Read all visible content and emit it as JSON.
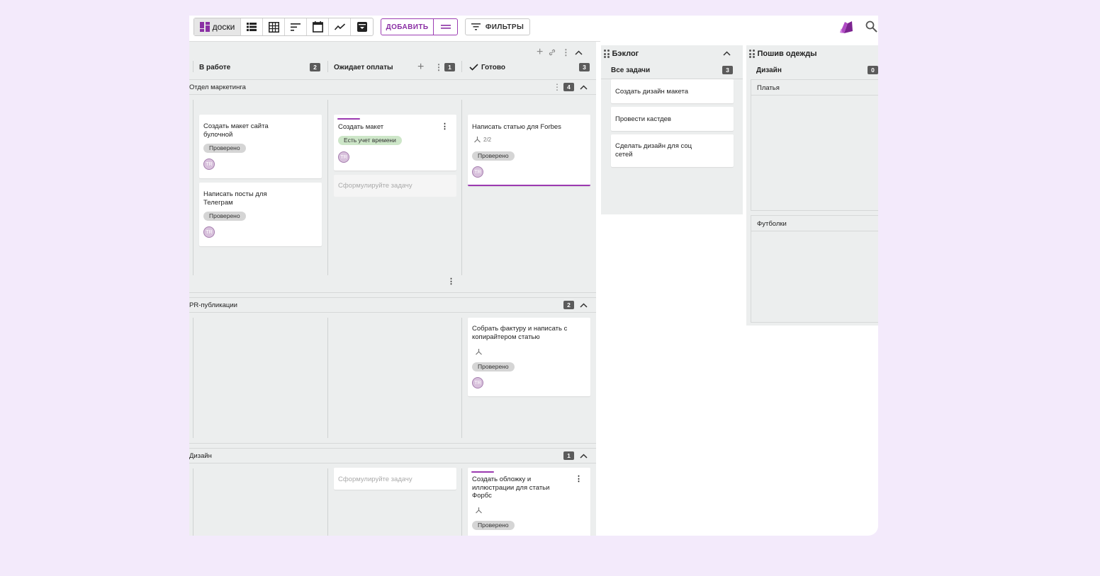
{
  "toolbar": {
    "boards_label": "доски",
    "add_label": "ДОБАВИТЬ",
    "filters_label": "ФИЛЬТРЫ",
    "view_icons": [
      "list-view-icon",
      "table-view-icon",
      "sort-icon",
      "calendar-icon",
      "chart-icon",
      "archive-icon"
    ]
  },
  "board": {
    "columns": [
      {
        "title": "В работе",
        "count": "2"
      },
      {
        "title": "Ожидает оплаты",
        "count": "1"
      },
      {
        "title": "Готово",
        "count": "3"
      }
    ],
    "swimlanes": [
      {
        "title": "Отдел маркетинга",
        "count": "4"
      },
      {
        "title": "PR-публикации",
        "count": "2"
      },
      {
        "title": "Дизайн",
        "count": "1"
      }
    ],
    "placeholder": "Сформулируйте задачу",
    "cards": {
      "c1": {
        "title_lines": [
          "Создать макет сайта",
          "булочной"
        ],
        "tag": "Проверено",
        "avatar": "TR"
      },
      "c2": {
        "title_lines": [
          "Написать посты для",
          "Телеграм"
        ],
        "tag": "Проверено",
        "avatar": "TR"
      },
      "c3": {
        "title": "Создать макет",
        "tag": "Есть учет времени",
        "avatar": "TR"
      },
      "c4": {
        "title": "Написать статью для Forbes",
        "subtasks": "2/2",
        "tag": "Проверено",
        "avatar": "TR"
      },
      "c5": {
        "title_lines": [
          "Собрать фактуру и написать с",
          "копирайтером статью"
        ],
        "tag": "Проверено",
        "avatar": "TR"
      },
      "c6": {
        "title_lines": [
          "Создать обложку и",
          "иллюстрации для статьи",
          "Форбс"
        ],
        "tag": "Проверено",
        "avatar": "TR"
      }
    }
  },
  "backlog": {
    "title": "Бэклог",
    "column": "Все задачи",
    "count": "3",
    "cards": [
      "Создать дизайн макета",
      "Провести кастдев"
    ],
    "card3_lines": [
      "Сделать дизайн для соц",
      "сетей"
    ]
  },
  "sewing": {
    "title": "Пошив одежды",
    "column": "Дизайн",
    "count": "0",
    "groups": [
      "Платья",
      "Футболки"
    ]
  },
  "colors": {
    "accent": "#9b39b0",
    "background": "#f3eafb",
    "board": "#eceeee"
  }
}
